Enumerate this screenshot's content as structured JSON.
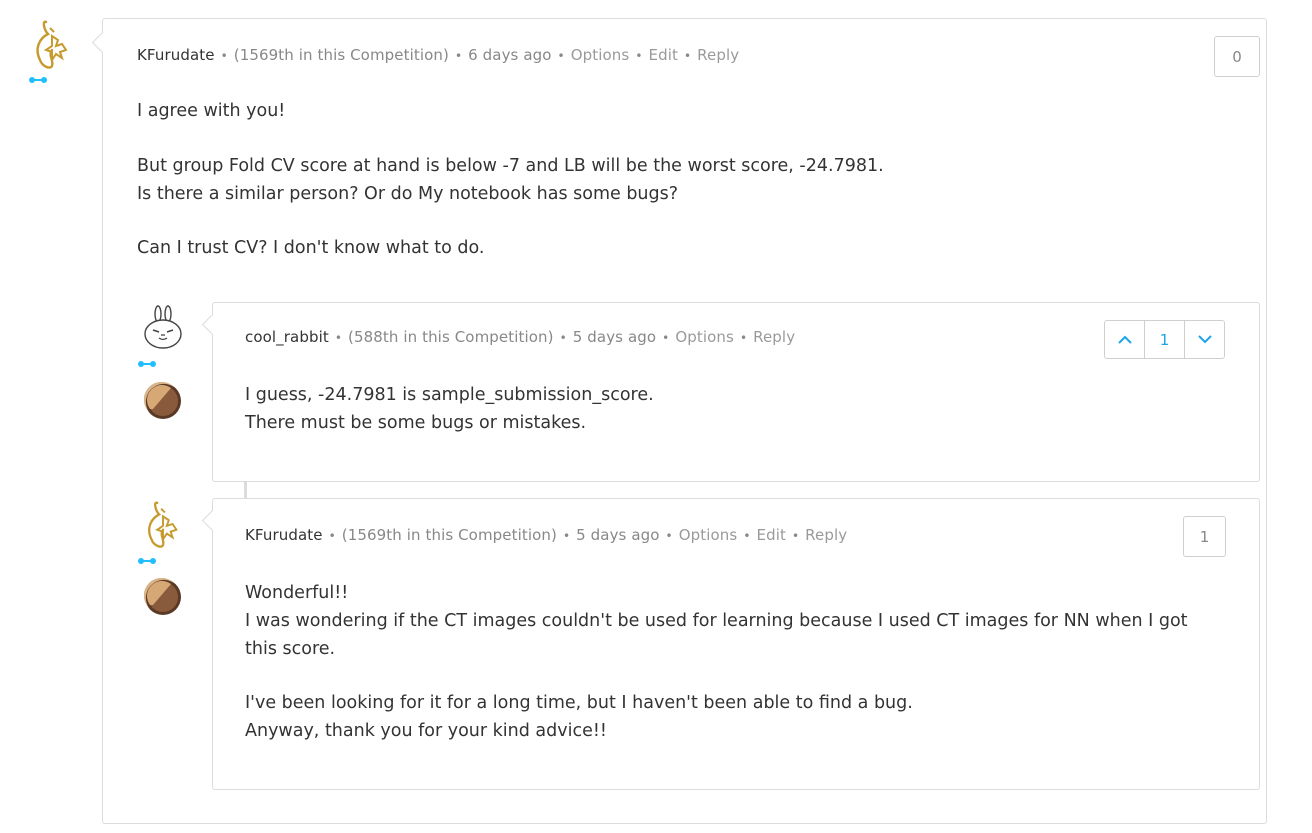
{
  "comments": [
    {
      "author": "KFurudate",
      "rank": "(1569th in this Competition)",
      "time": "6 days ago",
      "options": "Options",
      "edit": "Edit",
      "reply": "Reply",
      "votes": "0",
      "avatar_icon": "golden-fox-avatar-icon",
      "paragraphs": [
        "I agree with you!",
        "But group Fold CV score at hand is below -7 and LB will be the worst score, -24.7981.\nIs there a similar person? Or do My notebook has some bugs?",
        "Can I trust CV? I don't know what to do."
      ]
    },
    {
      "author": "cool_rabbit",
      "rank": "(588th in this Competition)",
      "time": "5 days ago",
      "options": "Options",
      "reply": "Reply",
      "votes": "1",
      "avatar_icon": "rabbit-avatar-icon",
      "paragraphs": [
        "I guess, -24.7981 is sample_submission_score.\nThere must be some bugs or mistakes."
      ]
    },
    {
      "author": "KFurudate",
      "rank": "(1569th in this Competition)",
      "time": "5 days ago",
      "options": "Options",
      "edit": "Edit",
      "reply": "Reply",
      "votes": "1",
      "avatar_icon": "golden-fox-avatar-icon",
      "paragraphs": [
        "Wonderful!!\nI was wondering if the CT images couldn't be used for learning because I used CT images for NN when I got this score.",
        "I've been looking for it for a long time, but I haven't been able to find a bug.\nAnyway, thank you for your kind advice!!"
      ]
    }
  ],
  "colors": {
    "border": "#dcdcdc",
    "meta_text": "#888888",
    "body_text": "#333333",
    "upvote_accent": "#1ba4e8",
    "tier_dot": "#20beff",
    "avatar_gold": "#c79a2e",
    "medal_brown": "#8a5a3c"
  }
}
